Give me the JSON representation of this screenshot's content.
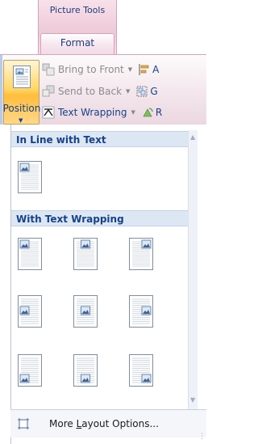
{
  "ribbon": {
    "context_group": "Picture Tools",
    "active_tab": "Format",
    "position_button": "Position",
    "commands": [
      {
        "label": "Bring to Front",
        "icon": "bring-to-front-icon",
        "enabled": false,
        "trailing_icon": "align-icon",
        "trailing_text": "A"
      },
      {
        "label": "Send to Back",
        "icon": "send-to-back-icon",
        "enabled": false,
        "trailing_icon": "group-icon",
        "trailing_text": "G"
      },
      {
        "label": "Text Wrapping",
        "icon": "text-wrapping-icon",
        "enabled": true,
        "trailing_icon": "rotate-icon",
        "trailing_text": "R"
      }
    ]
  },
  "gallery": {
    "sections": [
      {
        "title": "In Line with Text",
        "options": [
          "inline-top-left"
        ]
      },
      {
        "title": "With Text Wrapping",
        "options": [
          "top-left",
          "top-center",
          "top-right",
          "middle-left",
          "middle-center",
          "middle-right",
          "bottom-left",
          "bottom-center",
          "bottom-right"
        ]
      }
    ]
  },
  "footer": {
    "more_pre": "More ",
    "more_underlined": "L",
    "more_post": "ayout Options..."
  },
  "colors": {
    "accent_pink": "#eec9d7",
    "header_blue": "#dde6f3",
    "text_blue": "#15428b",
    "hover_orange": "#ffbd3c"
  }
}
